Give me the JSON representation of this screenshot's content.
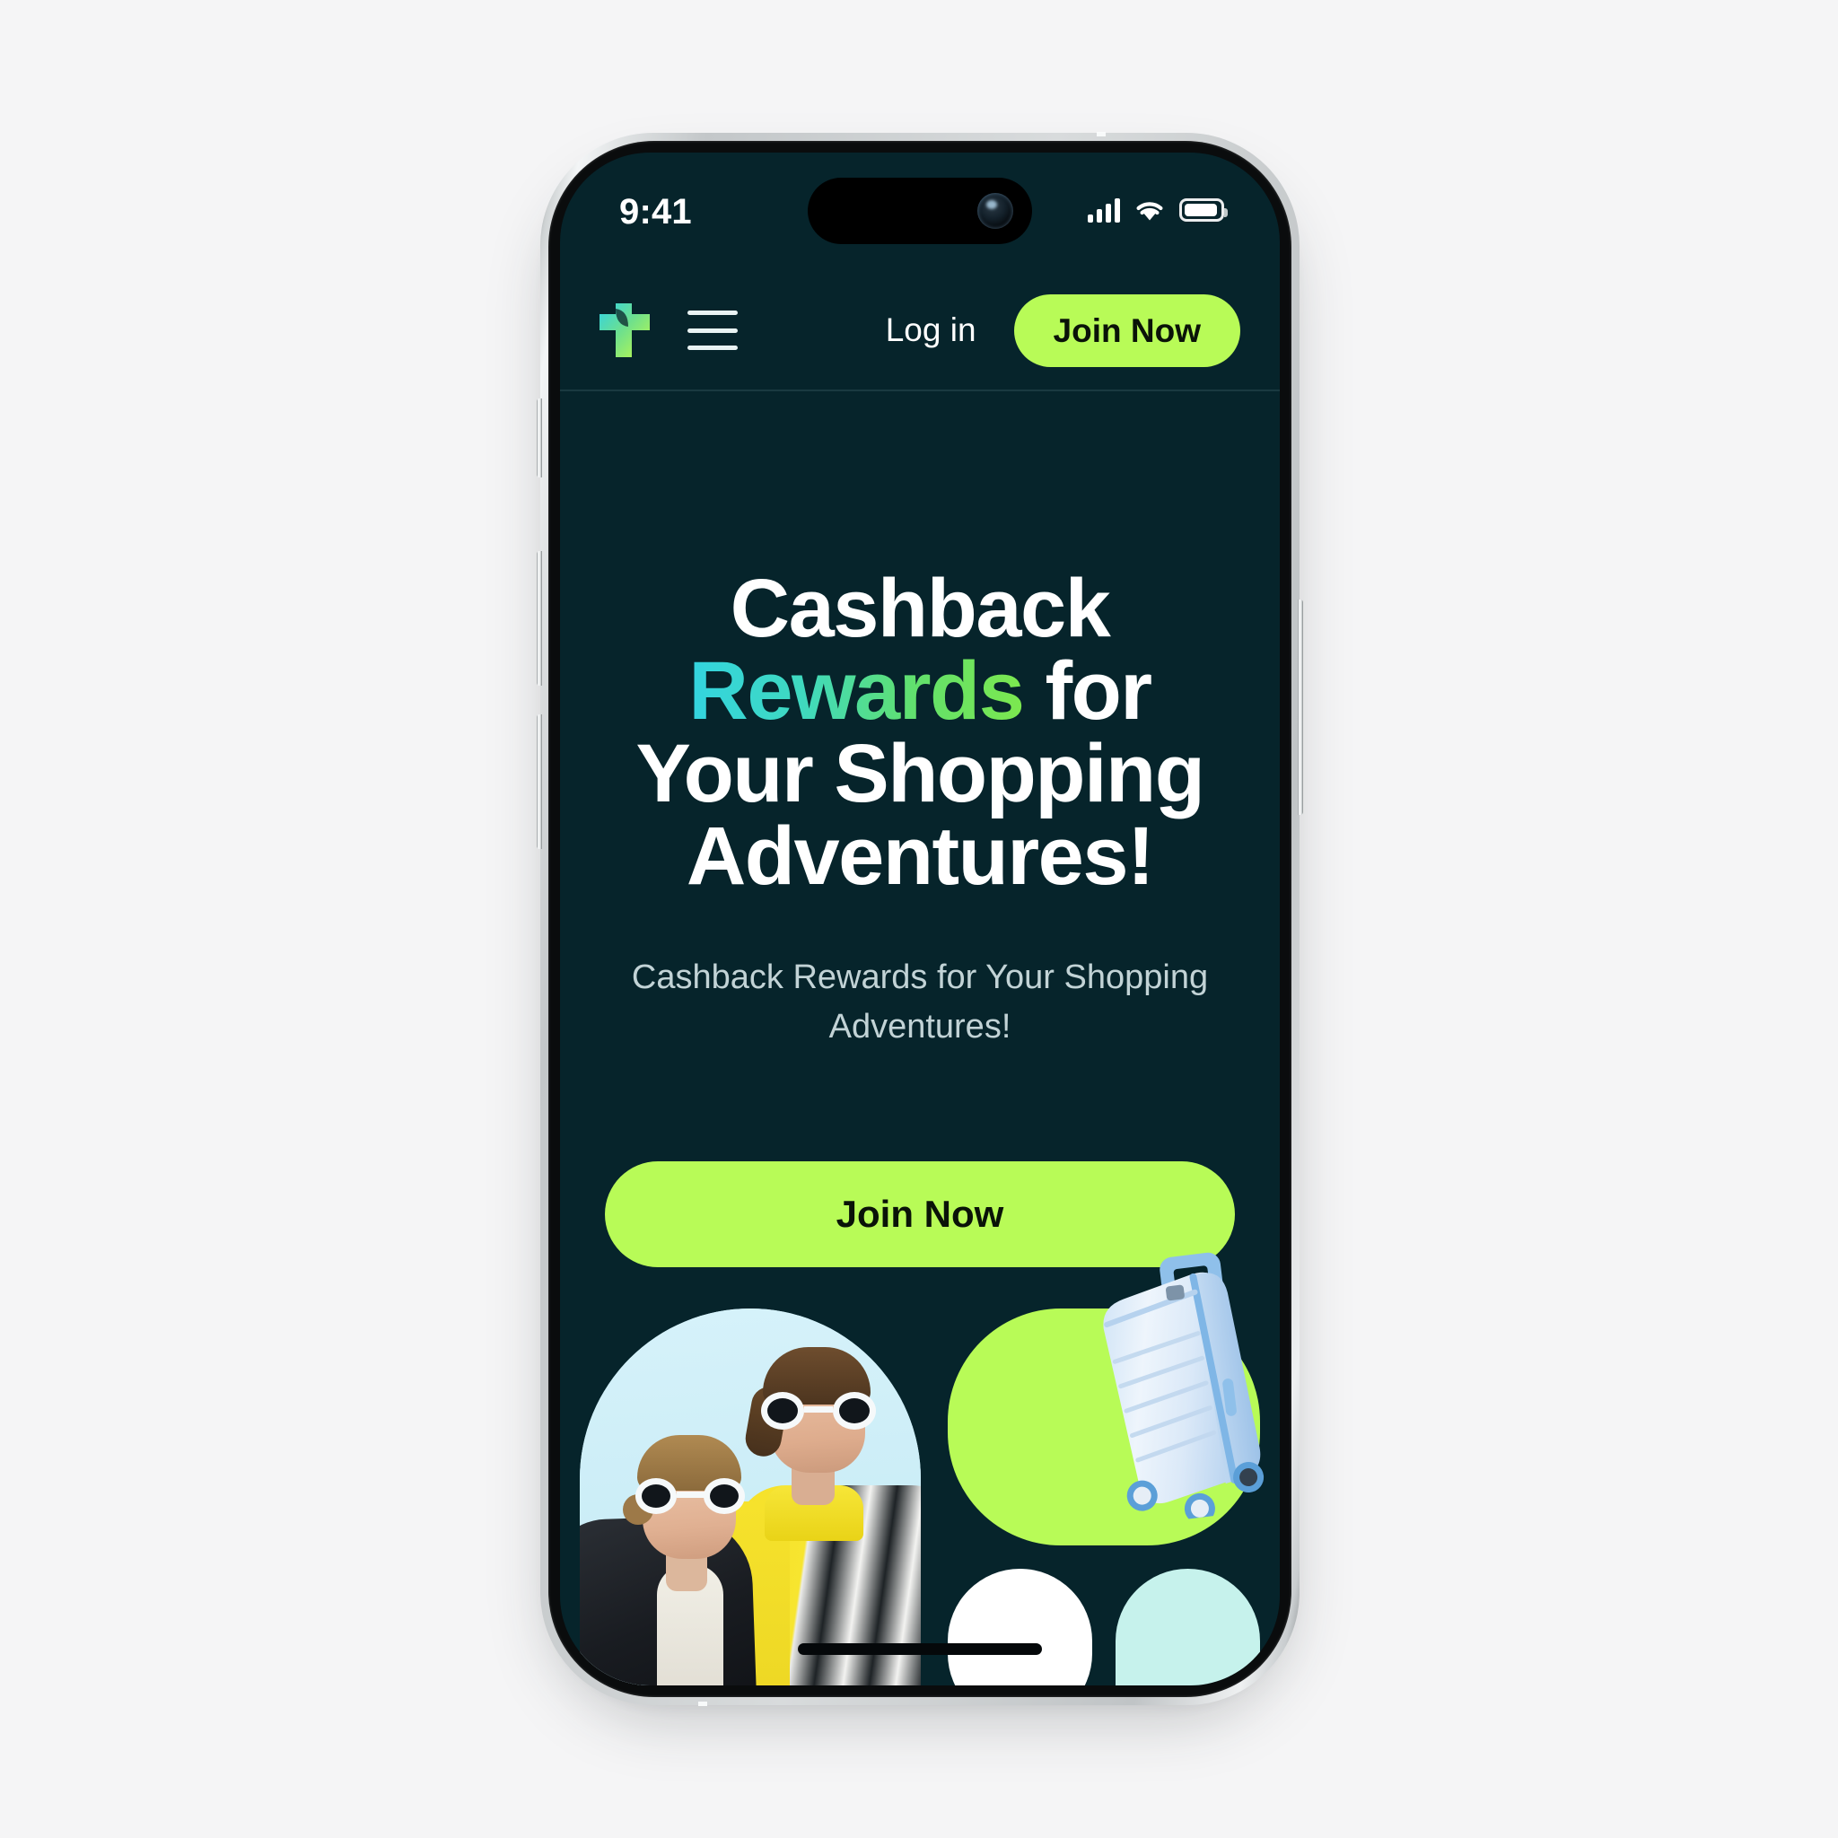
{
  "device": {
    "type": "smartphone-mockup",
    "frame_color": "#d2d6d7",
    "screen_background": "#06242b"
  },
  "status_bar": {
    "time": "9:41",
    "cellular_icon": "cellular-bars-icon",
    "wifi_icon": "wifi-icon",
    "battery_icon": "battery-full-icon"
  },
  "header": {
    "logo_name": "brand-plus-logo",
    "logo_gradient_from": "#2fd2e6",
    "logo_gradient_to": "#b8fb57",
    "menu_icon": "hamburger-menu-icon",
    "login_label": "Log in",
    "join_label": "Join Now",
    "join_button_color": "#b8fb57",
    "join_button_text_color": "#0a1308"
  },
  "hero": {
    "headline_part1": "Cashback ",
    "headline_highlight": "Rewards",
    "headline_part2": " for Your Shopping Adventures!",
    "headline_gradient_from": "#33d4e0",
    "headline_gradient_to": "#7ce84f",
    "subtitle": "Cashback Rewards for Your Shopping Adventures!",
    "subtitle_color": "#c2d3d6",
    "cta_label": "Join Now",
    "cta_color": "#b8fb57",
    "cta_text_color": "#0a1308"
  },
  "gallery": {
    "photo_models": {
      "name": "fashion-models-photo",
      "description": "Two women wearing white round sunglasses",
      "background_color": "#cdeef7",
      "shape": "arch"
    },
    "tile_suitcase": {
      "name": "suitcase-tile",
      "background_color": "#b8fb57",
      "product": "light-blue-hardshell-suitcase",
      "shape": "rounded-square"
    },
    "tile_white": {
      "name": "white-placeholder-tile",
      "background_color": "#ffffff",
      "shape": "pill"
    },
    "tile_cyan": {
      "name": "cyan-placeholder-tile",
      "background_color": "#c6f2ec",
      "shape": "arch"
    }
  },
  "home_indicator": {
    "name": "home-indicator",
    "color": "#05080a"
  }
}
